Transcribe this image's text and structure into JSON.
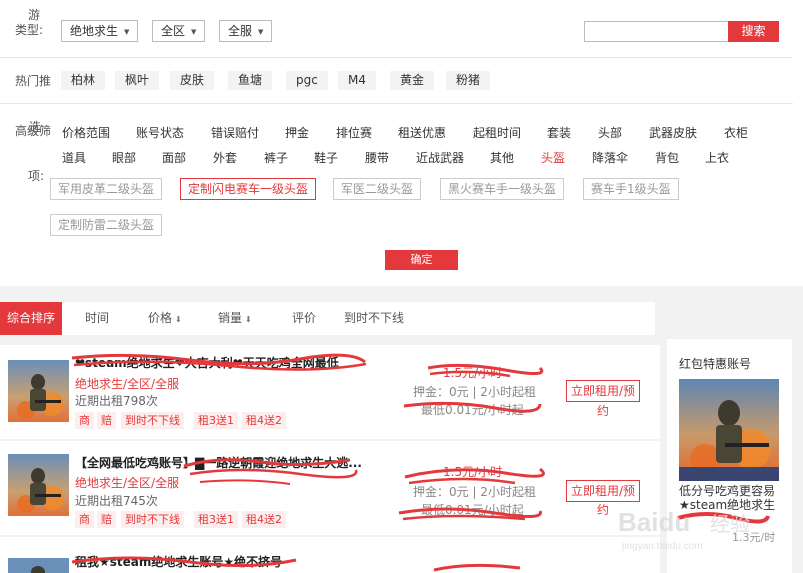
{
  "filters": {
    "game_label_line1": "游",
    "game_label_line2": "类型:",
    "game": "绝地求生",
    "region": "全区",
    "server": "全服",
    "search_placeholder": "",
    "search_button": "搜索"
  },
  "hot": {
    "label": "热门推",
    "tags": [
      "柏林",
      "枫叶",
      "皮肤",
      "鱼塘",
      "pgc",
      "M4",
      "黄金",
      "粉猪"
    ]
  },
  "advanced": {
    "label_line1": "高级筛",
    "label_line2": "选",
    "label_line3": "项:",
    "row1": [
      "价格范围",
      "账号状态",
      "错误赔付",
      "押金",
      "排位赛",
      "租送优惠",
      "起租时间",
      "套装",
      "头部",
      "武器皮肤",
      "衣柜"
    ],
    "row2": [
      "道具",
      "眼部",
      "面部",
      "外套",
      "裤子",
      "鞋子",
      "腰带",
      "近战武器",
      "其他",
      "头盔",
      "降落伞",
      "背包",
      "上衣"
    ],
    "active_item": "头盔",
    "sub_tags": [
      "军用皮革二级头盔",
      "定制闪电赛车一级头盔",
      "军医二级头盔",
      "黑火赛车手一级头盔",
      "赛车手1级头盔",
      "定制防雷二级头盔"
    ],
    "active_sub_tag": "定制闪电赛车一级头盔",
    "confirm": "确定"
  },
  "sort": {
    "items": [
      "综合排序",
      "时间",
      "价格",
      "销量",
      "评价",
      "到时不下线"
    ]
  },
  "listings": [
    {
      "title": "❤steam绝地求生❤大吉大利❤天天吃鸡全网最低",
      "sub": "绝地求生/全区/全服",
      "count": "近期出租798次",
      "tags": [
        "商",
        "赔",
        "到时不下线",
        "租3送1",
        "租4送2"
      ],
      "price": "1.5元/小时",
      "deposit": "押金：0元 | 2小时起租",
      "min": "最低0.01元/小时起",
      "button_line1": "立即租用/预",
      "button_line2": "约"
    },
    {
      "title": "【全网最低吃鸡账号】▇一路逆朝霞迎绝地求生大逃...",
      "sub": "绝地求生/全区/全服",
      "count": "近期出租745次",
      "tags": [
        "商",
        "赔",
        "到时不下线",
        "租3送1",
        "租4送2"
      ],
      "price": "1.5元/小时",
      "deposit": "押金：0元 | 2小时起租",
      "min": "最低0.01元/小时起",
      "button_line1": "立即租用/预",
      "button_line2": "约"
    },
    {
      "title": "租我★steam绝地求生账号★绝不挤号"
    }
  ],
  "sidebar": {
    "title": "红包特惠账号",
    "name": "低分号吃鸡更容易★steam绝地求生",
    "price": "1.3元/时"
  },
  "colors": {
    "accent": "#e4393c"
  }
}
